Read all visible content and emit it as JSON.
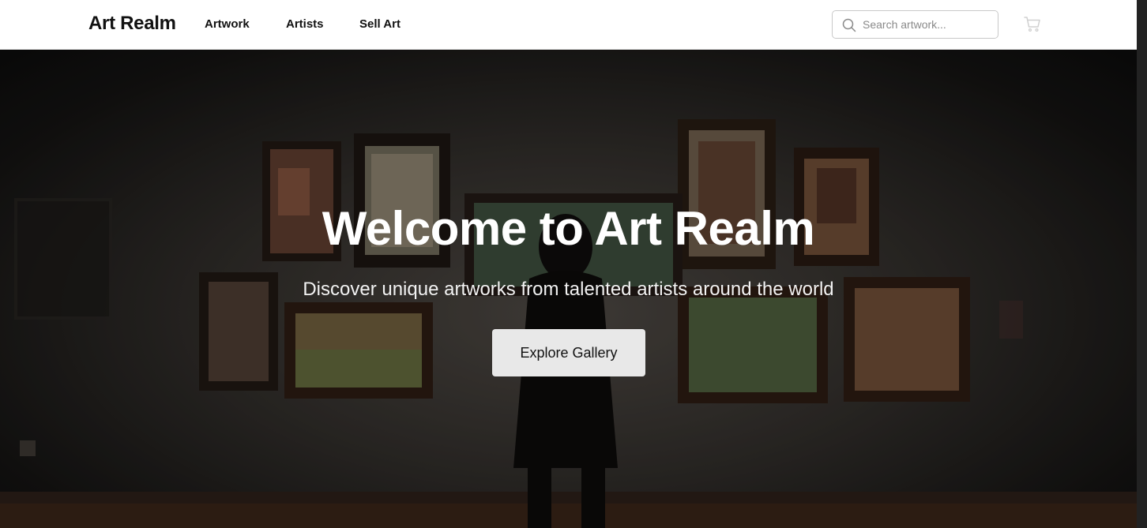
{
  "header": {
    "brand": "Art Realm",
    "nav": [
      {
        "label": "Artwork"
      },
      {
        "label": "Artists"
      },
      {
        "label": "Sell Art"
      }
    ],
    "search": {
      "placeholder": "Search artwork...",
      "value": ""
    },
    "icons": {
      "search": "search-icon",
      "cart": "shopping-cart-icon"
    }
  },
  "hero": {
    "title": "Welcome to Art Realm",
    "subtitle": "Discover unique artworks from talented artists around the world",
    "cta_label": "Explore Gallery",
    "background": "gallery-wall-with-paintings-and-visitor-silhouette"
  },
  "colors": {
    "brand_text": "#111111",
    "cta_background": "#e8e8e8",
    "hero_text": "#ffffff"
  }
}
